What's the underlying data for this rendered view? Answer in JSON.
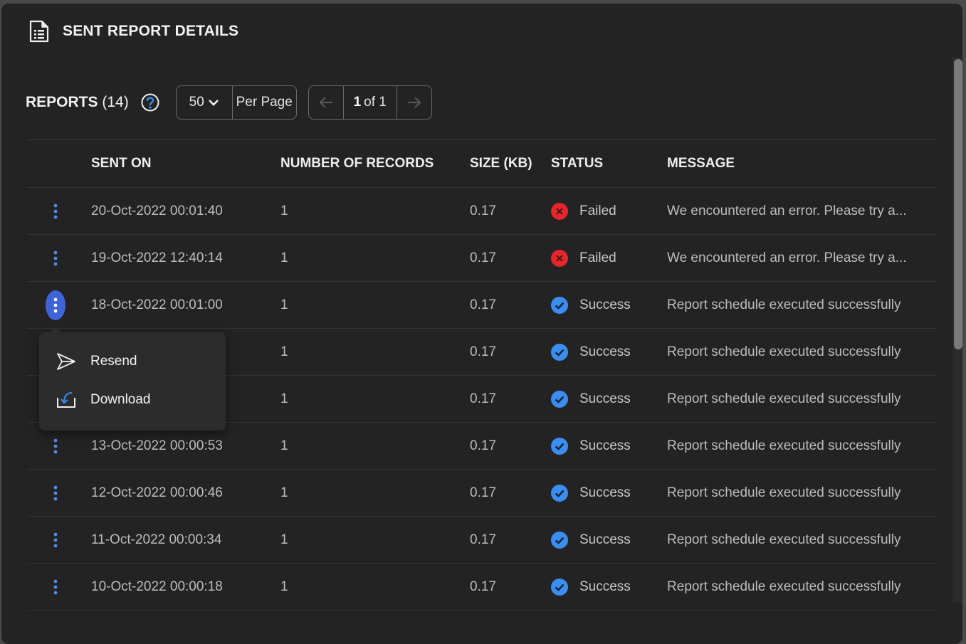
{
  "header": {
    "title": "SENT REPORT DETAILS",
    "icon": "document-list-icon"
  },
  "toolbar": {
    "reports_label": "REPORTS",
    "reports_count": "(14)",
    "per_page_value": "50",
    "per_page_label": "Per Page",
    "current_page": "1",
    "page_of": "of 1"
  },
  "table": {
    "columns": [
      "SENT ON",
      "NUMBER OF RECORDS",
      "SIZE (KB)",
      "STATUS",
      "MESSAGE"
    ],
    "rows": [
      {
        "sent_on": "20-Oct-2022 00:01:40",
        "records": "1",
        "size": "0.17",
        "status": "Failed",
        "message": "We encountered an error. Please try a..."
      },
      {
        "sent_on": "19-Oct-2022 12:40:14",
        "records": "1",
        "size": "0.17",
        "status": "Failed",
        "message": "We encountered an error. Please try a..."
      },
      {
        "sent_on": "18-Oct-2022 00:01:00",
        "records": "1",
        "size": "0.17",
        "status": "Success",
        "message": "Report schedule executed successfully"
      },
      {
        "sent_on": "",
        "records": "1",
        "size": "0.17",
        "status": "Success",
        "message": "Report schedule executed successfully"
      },
      {
        "sent_on": "",
        "records": "1",
        "size": "0.17",
        "status": "Success",
        "message": "Report schedule executed successfully"
      },
      {
        "sent_on": "13-Oct-2022 00:00:53",
        "records": "1",
        "size": "0.17",
        "status": "Success",
        "message": "Report schedule executed successfully"
      },
      {
        "sent_on": "12-Oct-2022 00:00:46",
        "records": "1",
        "size": "0.17",
        "status": "Success",
        "message": "Report schedule executed successfully"
      },
      {
        "sent_on": "11-Oct-2022 00:00:34",
        "records": "1",
        "size": "0.17",
        "status": "Success",
        "message": "Report schedule executed successfully"
      },
      {
        "sent_on": "10-Oct-2022 00:00:18",
        "records": "1",
        "size": "0.17",
        "status": "Success",
        "message": "Report schedule executed successfully"
      }
    ]
  },
  "context_menu": {
    "items": [
      {
        "label": "Resend",
        "icon": "send-icon"
      },
      {
        "label": "Download",
        "icon": "download-icon"
      }
    ]
  },
  "colors": {
    "accent": "#3f63d8",
    "kebab": "#4a8ef5",
    "success": "#3b8ef0",
    "failed": "#e3262b"
  }
}
